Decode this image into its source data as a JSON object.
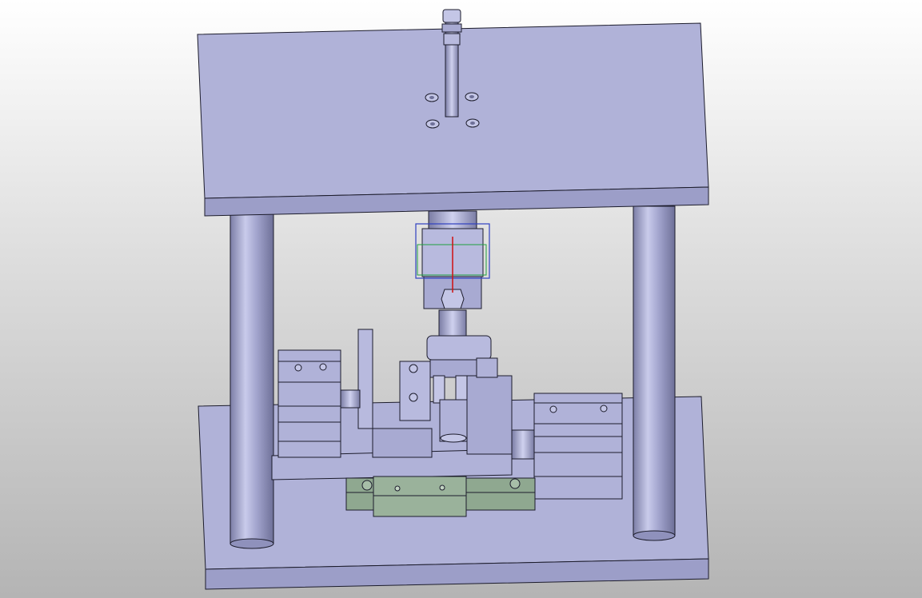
{
  "viewport": {
    "background_top": "#ffffff",
    "background_bottom": "#b4b4b4"
  },
  "model": {
    "part_color": "#b0b2d8",
    "part_shadow": "#8f91bc",
    "rail_color": "#8fa890",
    "outline_color": "#1c1c2c",
    "selection_box_colors": [
      "#3040c0",
      "#20a040",
      "#d01010"
    ]
  }
}
